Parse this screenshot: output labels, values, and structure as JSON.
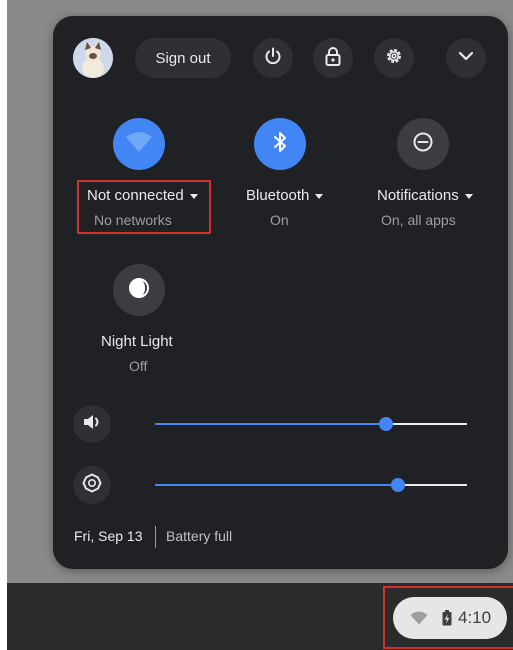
{
  "top_row": {
    "sign_out_label": "Sign out",
    "icons": [
      "avatar",
      "power-icon",
      "lock-icon",
      "settings-icon",
      "chevron-down-icon"
    ]
  },
  "pods": [
    {
      "label": "Not connected",
      "sublabel": "No networks",
      "icon": "wifi-icon",
      "active": true
    },
    {
      "label": "Bluetooth",
      "sublabel": "On",
      "icon": "bluetooth-icon",
      "active": true
    },
    {
      "label": "Notifications",
      "sublabel": "On, all apps",
      "icon": "do-not-disturb-icon",
      "active": false
    },
    {
      "label": "Night Light",
      "sublabel": "Off",
      "icon": "night-light-icon",
      "active": false
    }
  ],
  "sliders": {
    "volume_level": 0.74,
    "brightness_level": 0.78
  },
  "footer": {
    "date": "Fri, Sep 13",
    "battery": "Battery full"
  },
  "shelf": {
    "time": "4:10"
  },
  "colors": {
    "accent": "#4285f4",
    "panel_bg": "#202124",
    "highlight": "#d32f2f"
  }
}
